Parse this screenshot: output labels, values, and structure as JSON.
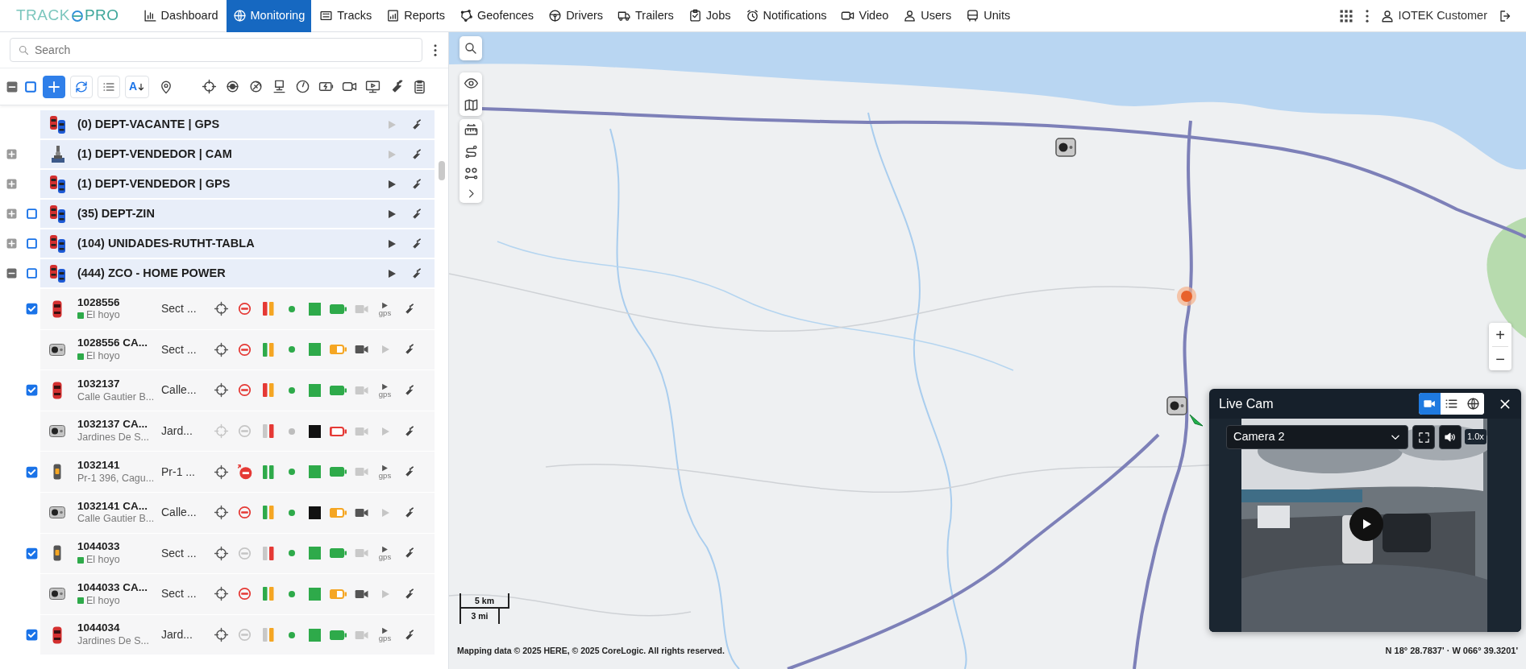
{
  "logo": {
    "left": "TRACK",
    "right": "PRO"
  },
  "nav": [
    {
      "label": "Dashboard",
      "selected": false
    },
    {
      "label": "Monitoring",
      "selected": true
    },
    {
      "label": "Tracks",
      "selected": false
    },
    {
      "label": "Reports",
      "selected": false
    },
    {
      "label": "Geofences",
      "selected": false
    },
    {
      "label": "Drivers",
      "selected": false
    },
    {
      "label": "Trailers",
      "selected": false
    },
    {
      "label": "Jobs",
      "selected": false
    },
    {
      "label": "Notifications",
      "selected": false
    },
    {
      "label": "Video",
      "selected": false
    },
    {
      "label": "Users",
      "selected": false
    },
    {
      "label": "Units",
      "selected": false
    }
  ],
  "user": {
    "name": "IOTEK Customer"
  },
  "sidebar": {
    "search": {
      "placeholder": "Search"
    },
    "toolbar": {
      "sort_label": "A",
      "select_all_checked": false
    },
    "groups": [
      {
        "label": "(0) DEPT-VACANTE | GPS",
        "kind": "cars",
        "play_enabled": false
      },
      {
        "label": "(1) DEPT-VENDEDOR | CAM",
        "kind": "camera",
        "expanded": false,
        "play_enabled": false
      },
      {
        "label": "(1) DEPT-VENDEDOR | GPS",
        "kind": "cars",
        "expanded": false,
        "play_enabled": true
      },
      {
        "label": "(35) DEPT-ZIN",
        "kind": "cars",
        "expanded": false,
        "checked": false,
        "play_enabled": true
      },
      {
        "label": "(104) UNIDADES-RUTHT-TABLA",
        "kind": "cars",
        "expanded": false,
        "checked": false,
        "play_enabled": true
      },
      {
        "label": "(444) ZCO - HOME POWER",
        "kind": "cars",
        "expanded": true,
        "checked": false,
        "play_enabled": true,
        "children": [
          {
            "name": "1028556",
            "location": "El hoyo",
            "geofence": true,
            "address": "Sect ...",
            "kind": "car",
            "checked": true,
            "connected": true,
            "blocked": true,
            "pending": false,
            "inputs": [
              {
                "color": "#e53935"
              },
              {
                "color": "#f5a623"
              }
            ],
            "online": true,
            "power": true,
            "battery": {
              "level": 1
            },
            "video": false,
            "play_label": "gps"
          },
          {
            "name": "1028556 CA...",
            "location": "El hoyo",
            "geofence": true,
            "address": "Sect ...",
            "kind": "camera",
            "connected": true,
            "blocked": true,
            "pending": false,
            "inputs": [
              {
                "color": "#2eaa4a"
              },
              {
                "color": "#f5a623"
              }
            ],
            "online": true,
            "power": true,
            "battery": {
              "level": 0.5
            },
            "video": true
          },
          {
            "name": "1032137",
            "location": "Calle Gautier B...",
            "geofence": false,
            "address": "Calle...",
            "kind": "car",
            "checked": true,
            "connected": true,
            "blocked": true,
            "pending": false,
            "inputs": [
              {
                "color": "#e53935"
              },
              {
                "color": "#f5a623"
              }
            ],
            "online": true,
            "power": true,
            "battery": {
              "level": 1
            },
            "video": false,
            "play_label": "gps"
          },
          {
            "name": "1032137 CA...",
            "location": "Jardines De S...",
            "geofence": false,
            "address": "Jard...",
            "kind": "camera",
            "connected": false,
            "blocked": false,
            "pending": false,
            "inputs": [
              {
                "color": "#c8c8c8"
              },
              {
                "color": "#e53935"
              }
            ],
            "online": false,
            "power": false,
            "battery": {
              "level": 0.15
            },
            "video": false
          },
          {
            "name": "1032141",
            "location": "Pr-1 396, Cagu...",
            "geofence": false,
            "address": "Pr-1 ...",
            "kind": "tracker",
            "checked": true,
            "connected": true,
            "blocked": true,
            "pending": true,
            "inputs": [
              {
                "color": "#2eaa4a"
              },
              {
                "color": "#2eaa4a"
              }
            ],
            "online": true,
            "power": true,
            "battery": {
              "level": 1
            },
            "video": false,
            "play_label": "gps"
          },
          {
            "name": "1032141 CA...",
            "location": "Calle Gautier B...",
            "geofence": false,
            "address": "Calle...",
            "kind": "camera",
            "connected": true,
            "blocked": true,
            "pending": false,
            "inputs": [
              {
                "color": "#2eaa4a"
              },
              {
                "color": "#f5a623"
              }
            ],
            "online": true,
            "power": false,
            "battery": {
              "level": 0.5
            },
            "video": true
          },
          {
            "name": "1044033",
            "location": "El hoyo",
            "geofence": true,
            "address": "Sect ...",
            "kind": "tracker",
            "checked": true,
            "connected": true,
            "blocked": false,
            "pending": false,
            "inputs": [
              {
                "color": "#c8c8c8"
              },
              {
                "color": "#e53935"
              }
            ],
            "online": true,
            "power": true,
            "battery": {
              "level": 1
            },
            "video": false,
            "play_label": "gps"
          },
          {
            "name": "1044033 CA...",
            "location": "El hoyo",
            "geofence": true,
            "address": "Sect ...",
            "kind": "camera",
            "connected": true,
            "blocked": true,
            "pending": false,
            "inputs": [
              {
                "color": "#2eaa4a"
              },
              {
                "color": "#f5a623"
              }
            ],
            "online": true,
            "power": true,
            "battery": {
              "level": 0.5
            },
            "video": true
          },
          {
            "name": "1044034",
            "location": "Jardines De S...",
            "geofence": false,
            "address": "Jard...",
            "kind": "car",
            "checked": true,
            "connected": true,
            "blocked": false,
            "pending": false,
            "inputs": [
              {
                "color": "#c8c8c8"
              },
              {
                "color": "#f5a623"
              }
            ],
            "online": true,
            "power": true,
            "battery": {
              "level": 1
            },
            "video": false,
            "play_label": "gps"
          }
        ]
      }
    ]
  },
  "map": {
    "kind": "picture",
    "zoom_in": "+",
    "zoom_out": "−",
    "scale": {
      "metric": "5 km",
      "imperial": "3 mi"
    },
    "attribution": "Mapping data © 2025 HERE, © 2025 CoreLogic. All rights reserved.",
    "coordinates": "N 18° 28.7837' · W 066° 39.3201'"
  },
  "live_cam": {
    "title": "Live Cam",
    "tabs": [
      {
        "selected": true
      },
      {
        "selected": false
      },
      {
        "selected": false
      }
    ],
    "camera": "Camera 2",
    "speed": "1.0x"
  }
}
